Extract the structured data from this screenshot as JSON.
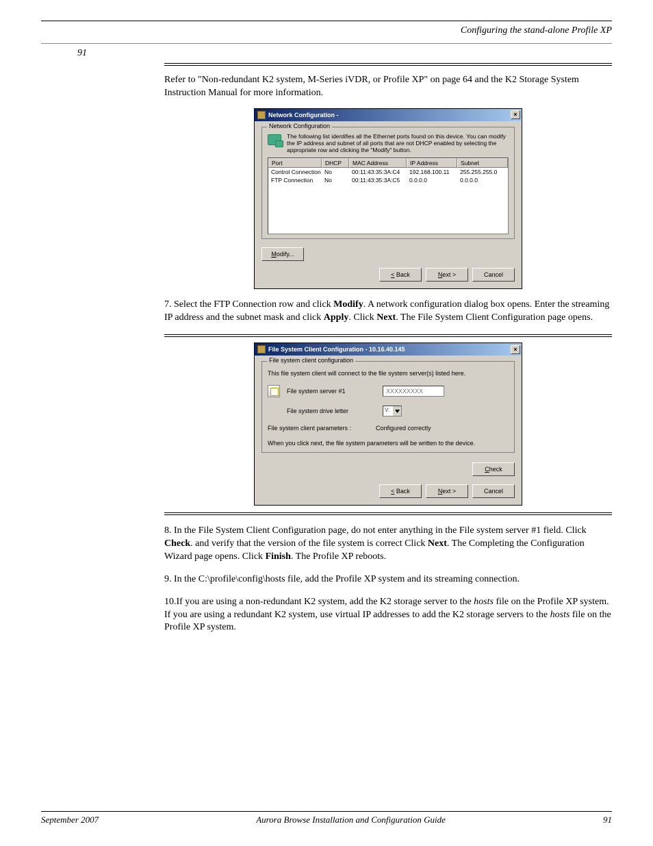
{
  "header": {
    "right": "Configuring the stand-alone Profile XP"
  },
  "page_number": "91",
  "notice_sentence": "Refer to \"Non-redundant K2 system, M-Series iVDR, or Profile XP\" on page 64 and the K2 Storage System Instruction Manual for more information.",
  "dialog1": {
    "title": "Network Configuration -",
    "group": "Network Configuration",
    "desc": "The following list identifies all the Ethernet ports found on this device. You can modify the IP address and subnet of all ports that are not DHCP enabled by selecting the appropriate row and clicking the \"Modify\" button.",
    "columns": {
      "port": "Port",
      "dhcp": "DHCP",
      "mac": "MAC Address",
      "ip": "IP Address",
      "subnet": "Subnet"
    },
    "rows": [
      {
        "port": "Control Connection",
        "dhcp": "No",
        "mac": "00:11:43:35:3A:C4",
        "ip": "192.168.100.11",
        "subnet": "255.255.255.0"
      },
      {
        "port": "FTP Connection",
        "dhcp": "No",
        "mac": "00:11:43:35:3A:C5",
        "ip": "0.0.0.0",
        "subnet": "0.0.0.0"
      }
    ],
    "modify": "Modify...",
    "back": "< Back",
    "next": "Next >",
    "cancel": "Cancel"
  },
  "step7_a": "7. Select the FTP Connection row and click ",
  "step7_b": "Modify",
  "step7_c": ". A network configuration dialog box opens. Enter the streaming IP address and the subnet mask and click ",
  "step7_d": "Apply",
  "step7_e": ". Click ",
  "step7_f": "Next",
  "step7_g": ". The File System Client Configuration page opens.",
  "dialog2": {
    "title": "File System Client Configuration - 10.16.40.145",
    "group": "File system client configuration",
    "line1": "This file system client will connect to the file system server(s) listed here.",
    "server_label": "File system server #1",
    "server_ph": "XXXXXXXXX",
    "drive_label": "File system drive letter",
    "drive_value": "V:",
    "params_label": "File system client parameters :",
    "params_value": "Configured correctly",
    "line2": "When you click next, the file system parameters will be written to the device.",
    "check": "Check",
    "back": "< Back",
    "next": "Next >",
    "cancel": "Cancel"
  },
  "step8_a": "8. In the File System Client Configuration page, do not enter anything in the File system server #1 field. Click ",
  "step8_b": "Check",
  "step8_c": ". and verify that the version of the file system is correct Click ",
  "step8_d": "Next",
  "step8_e": ". The Completing the Configuration Wizard page opens. Click ",
  "step8_f": "Finish",
  "step8_g": ". The Profile XP reboots.",
  "step9": "9. In the C:\\profile\\config\\hosts file, add the Profile XP system and its streaming connection.",
  "step10_a": "10.If you are using a non-redundant K2 system, add the K2 storage server to the ",
  "step10_b": "hosts",
  "step10_c": " file on the Profile XP system. If you are using a redundant K2 system, use virtual IP addresses to add the K2 storage servers to the ",
  "step10_d": "hosts",
  "step10_e": " file on the Profile XP system.",
  "footer": {
    "date": "September 2007",
    "title": "Aurora Browse Installation and Configuration Guide"
  }
}
